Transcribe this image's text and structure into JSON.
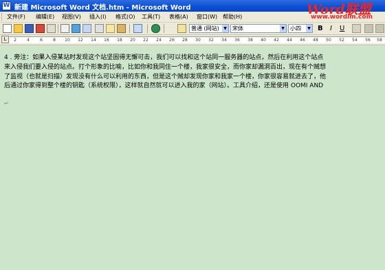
{
  "window": {
    "title": "新建 Microsoft Word 文档.htm - Microsoft Word"
  },
  "menu": [
    "文件(F)",
    "编辑(E)",
    "视图(V)",
    "插入(I)",
    "格式(O)",
    "工具(T)",
    "表格(A)",
    "窗口(W)",
    "帮助(H)"
  ],
  "toolbar": {
    "style_value": "普通 (网站)",
    "font_value": "宋体",
    "size_value": "小四",
    "bold_label": "B",
    "italic_label": "I",
    "underline_label": "U"
  },
  "ruler": {
    "marker": "L",
    "ticks": [
      "2",
      "4",
      "6",
      "8",
      "10",
      "12",
      "14",
      "16",
      "18",
      "20",
      "22",
      "24",
      "26",
      "28",
      "30",
      "32",
      "34",
      "36",
      "38",
      "40",
      "42",
      "44",
      "46",
      "48",
      "50",
      "52",
      "54",
      "56",
      "58"
    ]
  },
  "document": {
    "lines": [
      "4 . 旁注：如果入侵某站时发现这个站坚固得无懈可击，我们可以找和这个站同一服务器的站点，然后在利用这个站点",
      "来入侵我们要入侵的站点。打个形象的比喻，比如你和我同住一个楼，我家很安全，而你家却漏洞百出，现在有个贼想",
      "了监视（也就是扫描）发现没有什么可以利用的东西，但是这个贼却发现你家和我家一个楼，你家很容易就进去了，他",
      "后通过你家得到整个楼的钥匙（系统权限），这样就自然就可以进入我的家（网站）。工具介绍，还是使用 OOMI AND"
    ],
    "paragraph_mark": "↵"
  },
  "watermark": {
    "brand": "Word联盟",
    "url": "www.wordlm.com",
    "color": "#e8262a"
  }
}
